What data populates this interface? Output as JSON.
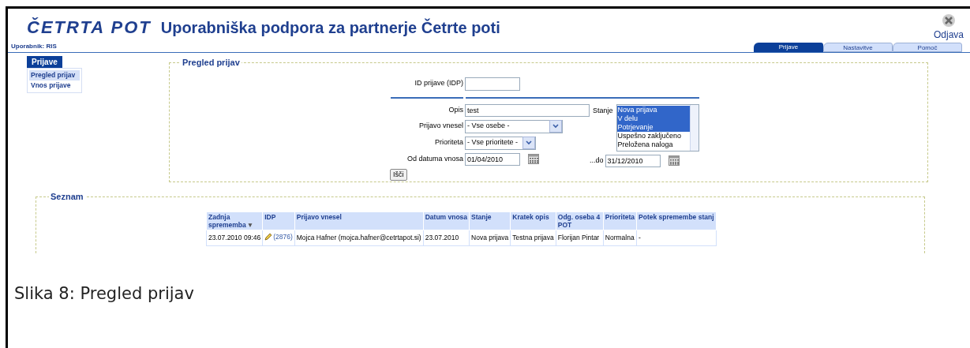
{
  "header": {
    "logo": "ČETRTA POT",
    "title": "Uporabniška podpora za partnerje Četrte poti",
    "logout": "Odjava",
    "user": "Uporabnik: RIS"
  },
  "tabs": [
    {
      "label": "Prijave",
      "selected": true
    },
    {
      "label": "Nastavitve",
      "selected": false
    },
    {
      "label": "Pomoč",
      "selected": false
    }
  ],
  "sidebar": {
    "heading": "Prijave",
    "items": [
      {
        "label": "Pregled prijav",
        "selected": true
      },
      {
        "label": "Vnos prijave",
        "selected": false
      }
    ]
  },
  "search_form": {
    "legend": "Pregled prijav",
    "id_label": "ID prijave (IDP)",
    "opis_label": "Opis",
    "opis_value": "test",
    "vnesel_label": "Prijavo vnesel",
    "vnesel_value": "- Vse osebe -",
    "prioriteta_label": "Prioriteta",
    "prioriteta_value": "- Vse prioritete -",
    "stanje_label": "Stanje",
    "stanje_options": [
      {
        "label": "Nova prijava",
        "selected": true
      },
      {
        "label": "V delu",
        "selected": true
      },
      {
        "label": "Potrjevanje",
        "selected": true
      },
      {
        "label": "Uspešno zaključeno",
        "selected": false
      },
      {
        "label": "Preložena naloga",
        "selected": false
      }
    ],
    "od_label": "Od datuma vnosa",
    "od_value": "01/04/2010",
    "do_label": "...do",
    "do_value": "31/12/2010",
    "search_button": "Išči"
  },
  "list": {
    "legend": "Seznam",
    "columns": [
      {
        "label": "Zadnja sprememba",
        "sort_mark": "▼"
      },
      {
        "label": "IDP"
      },
      {
        "label": "Prijavo vnesel"
      },
      {
        "label": "Datum vnosa"
      },
      {
        "label": "Stanje"
      },
      {
        "label": "Kratek opis"
      },
      {
        "label": "Odg. oseba 4 POT"
      },
      {
        "label": "Prioriteta"
      },
      {
        "label": "Potek spremembe stanj"
      }
    ],
    "rows": [
      {
        "cells": [
          "23.07.2010 09:46",
          "(2876)",
          "Mojca Hafner (mojca.hafner@cetrtapot.si)",
          "23.07.2010",
          "Nova prijava",
          "Testna prijava",
          "Florijan Pintar",
          "Normalna",
          "-"
        ]
      }
    ]
  },
  "caption": "Slika 8: Pregled prijav"
}
